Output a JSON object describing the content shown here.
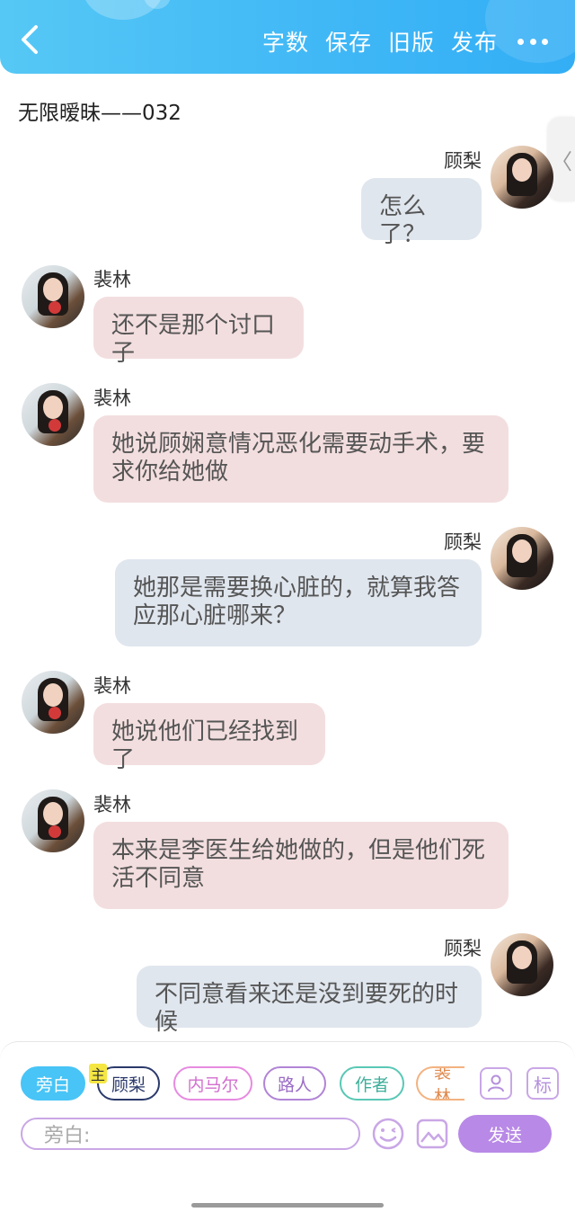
{
  "header": {
    "actions": [
      "字数",
      "保存",
      "旧版",
      "发布"
    ]
  },
  "title": "无限暧昧——032",
  "messages": [
    {
      "side": "right",
      "name": "顾梨",
      "text": "怎么了？"
    },
    {
      "side": "left",
      "name": "裴林",
      "text": "还不是那个讨口子"
    },
    {
      "side": "left",
      "name": "裴林",
      "text": "她说顾娴意情况恶化需要动手术，要求你给她做"
    },
    {
      "side": "right",
      "name": "顾梨",
      "text": "她那是需要换心脏的，就算我答应那心脏哪来？"
    },
    {
      "side": "left",
      "name": "裴林",
      "text": "她说他们已经找到了"
    },
    {
      "side": "left",
      "name": "裴林",
      "text": "本来是李医生给她做的，但是他们死活不同意"
    },
    {
      "side": "right",
      "name": "顾梨",
      "text": "不同意看来还是没到要死的时候"
    }
  ],
  "composer": {
    "roles": [
      "旁白",
      "顾梨",
      "内马尔",
      "路人",
      "作者",
      "裴林"
    ],
    "main_badge": "主",
    "tag_button": "标",
    "input_placeholder": "旁白:",
    "send_label": "发送"
  }
}
